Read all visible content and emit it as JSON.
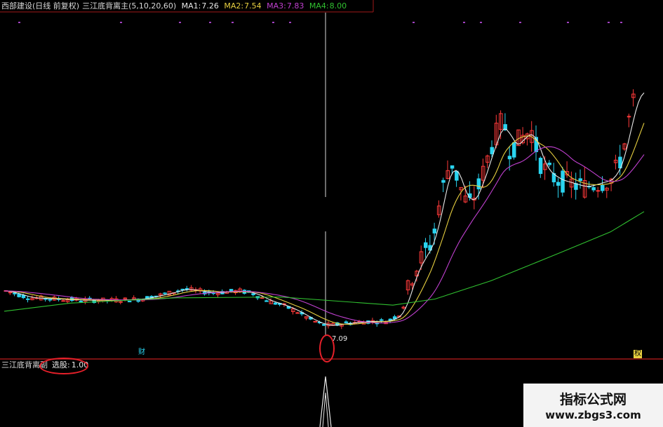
{
  "header": {
    "stock": "西部建设(日线 前复权)",
    "indicator": "三江底背离主",
    "params": "(5,10,20,60)",
    "ma1_label": "MA1:",
    "ma1_value": "7.26",
    "ma2_label": "MA2:",
    "ma2_value": "7.54",
    "ma3_label": "MA3:",
    "ma3_value": "7.83",
    "ma4_label": "MA4:",
    "ma4_value": "8.00"
  },
  "sub_panel": {
    "name": "三江底背离副",
    "signal_label": "选股:",
    "signal_value": "1.00"
  },
  "chart": {
    "low_price_label": "7.09",
    "marker_left": "财",
    "marker_right": "权"
  },
  "watermark": {
    "title": "指标公式网",
    "url": "www.zbgs3.com"
  },
  "colors": {
    "bg": "#000000",
    "up": "#ff3a3a",
    "down": "#2ad4f0",
    "ma1": "#e8e8e8",
    "ma2": "#e8d040",
    "ma3": "#c040d0",
    "ma4": "#30c030",
    "axis": "#a01818",
    "highlight": "#e8202a"
  },
  "chart_data": {
    "type": "line",
    "series": [
      {
        "name": "MA1",
        "values": [
          7.26
        ]
      },
      {
        "name": "MA2",
        "values": [
          7.54
        ]
      },
      {
        "name": "MA3",
        "values": [
          7.83
        ]
      },
      {
        "name": "MA4",
        "values": [
          8.0
        ]
      }
    ],
    "annotations": [
      "7.09"
    ],
    "signal": {
      "name": "选股",
      "value": 1.0
    }
  }
}
